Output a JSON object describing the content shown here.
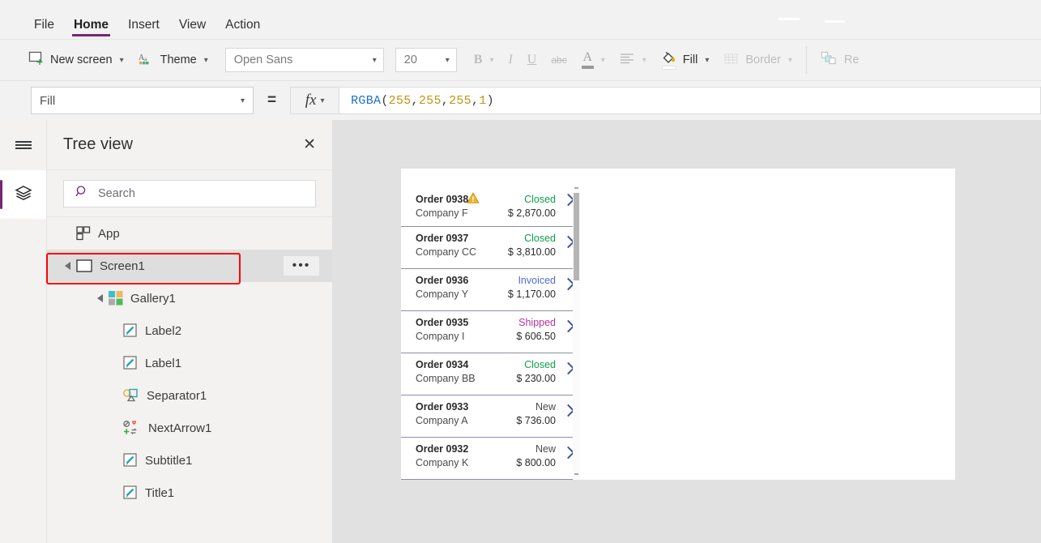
{
  "menu": {
    "tabs": [
      {
        "label": "File",
        "active": false
      },
      {
        "label": "Home",
        "active": true
      },
      {
        "label": "Insert",
        "active": false
      },
      {
        "label": "View",
        "active": false
      },
      {
        "label": "Action",
        "active": false
      }
    ]
  },
  "ribbon": {
    "new_screen": "New screen",
    "theme": "Theme",
    "font_name": "Open Sans",
    "font_size": "20",
    "bold": "B",
    "italic": "I",
    "underline": "U",
    "strikethrough": "abc",
    "font_color": "A",
    "align": "align-icon",
    "fill": "Fill",
    "border": "Border",
    "reorder": "Re",
    "icons": {
      "new_screen": "new-screen-icon",
      "theme": "theme-icon",
      "font_color": "font-color-icon",
      "align": "align-left-icon",
      "fill": "paint-bucket-icon",
      "border": "border-icon",
      "reorder": "reorder-icon"
    }
  },
  "formula_bar": {
    "property": "Fill",
    "equals": "=",
    "fx": "fx",
    "tokens": [
      {
        "text": "RGBA",
        "type": "fn"
      },
      {
        "text": "(",
        "type": "p"
      },
      {
        "text": "255",
        "type": "num"
      },
      {
        "text": ", ",
        "type": "p"
      },
      {
        "text": "255",
        "type": "num"
      },
      {
        "text": ", ",
        "type": "p"
      },
      {
        "text": "255",
        "type": "num"
      },
      {
        "text": ", ",
        "type": "p"
      },
      {
        "text": "1",
        "type": "num"
      },
      {
        "text": ")",
        "type": "p"
      }
    ]
  },
  "tree": {
    "title": "Tree view",
    "close": "✕",
    "search_placeholder": "Search",
    "more_label": "•••",
    "items": [
      {
        "label": "App",
        "indent": 1,
        "caret": false,
        "icon": "app-icon",
        "selected": false,
        "more": false
      },
      {
        "label": "Screen1",
        "indent": 1,
        "caret": true,
        "icon": "screen-icon",
        "selected": true,
        "more": true
      },
      {
        "label": "Gallery1",
        "indent": 2,
        "caret": true,
        "icon": "gallery-icon",
        "selected": false,
        "more": false
      },
      {
        "label": "Label2",
        "indent": 3,
        "caret": false,
        "icon": "label-icon",
        "selected": false,
        "more": false
      },
      {
        "label": "Label1",
        "indent": 3,
        "caret": false,
        "icon": "label-icon",
        "selected": false,
        "more": false
      },
      {
        "label": "Separator1",
        "indent": 3,
        "caret": false,
        "icon": "separator-icon",
        "selected": false,
        "more": false
      },
      {
        "label": "NextArrow1",
        "indent": 3,
        "caret": false,
        "icon": "nextarrow-icon",
        "selected": false,
        "more": false
      },
      {
        "label": "Subtitle1",
        "indent": 3,
        "caret": false,
        "icon": "label-icon",
        "selected": false,
        "more": false
      },
      {
        "label": "Title1",
        "indent": 3,
        "caret": false,
        "icon": "label-icon",
        "selected": false,
        "more": false
      }
    ]
  },
  "canvas": {
    "gallery_rows": [
      {
        "order": "Order 0938",
        "company": "Company F",
        "status": "Closed",
        "status_color": "#0f9e4a",
        "amount": "$ 2,870.00",
        "warning": true
      },
      {
        "order": "Order 0937",
        "company": "Company CC",
        "status": "Closed",
        "status_color": "#0f9e4a",
        "amount": "$ 3,810.00",
        "warning": false
      },
      {
        "order": "Order 0936",
        "company": "Company Y",
        "status": "Invoiced",
        "status_color": "#4f6ad0",
        "amount": "$ 1,170.00",
        "warning": false
      },
      {
        "order": "Order 0935",
        "company": "Company I",
        "status": "Shipped",
        "status_color": "#b4339c",
        "amount": "$ 606.50",
        "warning": false
      },
      {
        "order": "Order 0934",
        "company": "Company BB",
        "status": "Closed",
        "status_color": "#0f9e4a",
        "amount": "$ 230.00",
        "warning": false
      },
      {
        "order": "Order 0933",
        "company": "Company A",
        "status": "New",
        "status_color": "#4a4a4a",
        "amount": "$ 736.00",
        "warning": false
      },
      {
        "order": "Order 0932",
        "company": "Company K",
        "status": "New",
        "status_color": "#4a4a4a",
        "amount": "$ 800.00",
        "warning": false
      }
    ]
  },
  "colors": {
    "accent_purple": "#742774",
    "highlight_red": "#ff0000",
    "chevron_blue": "#41519e",
    "canvas_gray": "#e1e1e1"
  }
}
